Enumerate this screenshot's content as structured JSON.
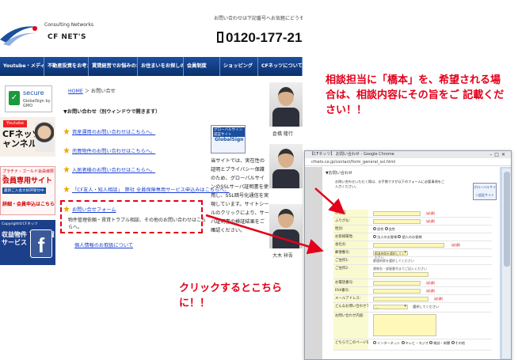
{
  "site": {
    "header": {
      "logo_small": "Consulting Networks",
      "logo_main": "CF NET'S",
      "topline": "お問い合わせは下記番号へお気軽にどうぞ",
      "phone": "0120-177-213"
    },
    "nav": [
      "Youtube・メディア",
      "不動産投資をお考えの方",
      "賃貸経営でお悩みのオーナー様",
      "お住まいをお探しの方",
      "会員制度",
      "ショッピング",
      "CFネッツについて"
    ],
    "sidebar": {
      "secure_title": "secure",
      "secure_sub": "GlobalSign by GMO",
      "youtube_badge": "Youtube",
      "youtube_text": "CFネッツ チャンネル",
      "member_top": "プラチナ・ゴールド会員様限定",
      "member_title": "会員専用サイト",
      "member_sub": "最新ご入会大好評受付中",
      "member_link": "詳細・会員申込はこちら",
      "fb_top": "Copyright©CFネッツ",
      "fb_title": "収益物件 下見速報 サービス",
      "fb_logo": "f"
    },
    "main": {
      "breadcrumb_home": "HOME",
      "breadcrumb_current": "お問い合せ",
      "heading": "▼お問い合わせ（別ウィンドウで開きます）",
      "links": [
        "資産運用のお問い合わせはこちらへ。",
        "売買物件のお問い合わせはこちらへ。",
        "入居者様のお問い合わせはこちらへ。",
        "「CF友人・知人相談」　弊社 全員保険専用サービス申込みはこちらへ。",
        "お問い合せフォーム"
      ],
      "form_desc": "物件管理依頼・賃貸トラブル相談、その他のお問い合わせはこちらへ。",
      "privacy_link": "個人情報のお取扱について"
    },
    "globalsign": {
      "badge": "グローバルサイン認証サイト",
      "brand": "GlobalSign",
      "text": "当サイトでは、実在性の証明とプライバシー保護のため、グローバルサインのSSLサーバ証明書を使用し、SSL暗号化通信を実現しています。サイトシールのクリックにより、サーバ証明書の検証結果をご確認ください。"
    },
    "photos": [
      "倉橋 隆行",
      "",
      "大木 祥吾"
    ]
  },
  "annotations": {
    "top": "相談担当に「橋本」を、希望される場合は、相談内容にその旨をご 記載ください！！",
    "bottom": "クリックするとこちらに！！"
  },
  "browser": {
    "title": "【CFネッツ】 お問い合わせ - Google Chrome",
    "url": "cfnets.co.jp/contact/form_general_ssl.html",
    "page_heading": "▼お問い合わせ",
    "intro": "お問い合わせいただく際は、お手数ですが以下のフォームに必要事項をご入力ください。",
    "gs_badge": "グローバルサイン認証サイト",
    "fields": [
      {
        "label": "お名前:",
        "req": "（必須）"
      },
      {
        "label": "ふりがな:",
        "req": "（必須）"
      },
      {
        "label": "性別:",
        "options": [
          "男性",
          "女性"
        ]
      },
      {
        "label": "お客様属性:",
        "options": [
          "法人のお客様",
          "個人のお客様"
        ]
      },
      {
        "label": "会社名:",
        "req": "（必須）"
      },
      {
        "label": "郵便番号:",
        "select": "都道府県を選択してください"
      },
      {
        "label": "ご住所1:",
        "note": "都道府県を選択してください"
      },
      {
        "label": "ご住所2:",
        "note": "建物名・部屋番号までご記入ください"
      },
      {
        "label": "お電話番号:",
        "req": "（必須）"
      },
      {
        "label": "FAX番号:",
        "req": "（必須）"
      },
      {
        "label": "メールアドレス:",
        "req": "（必須）"
      },
      {
        "label": "どんなお問い合わせですか？:",
        "select": "----",
        "note": "選択してください"
      },
      {
        "label": "お問い合わせ内容:"
      },
      {
        "label": "どちらでこのページを知りましたか？:",
        "options": [
          "インターネット",
          "テレビ・ラジオ",
          "雑誌・新聞",
          "その他"
        ]
      }
    ]
  },
  "colors": {
    "annotation": "#e2001a",
    "nav": "#0b2f6b",
    "link": "#1a3fd0",
    "form_input": "#fff8b8"
  }
}
